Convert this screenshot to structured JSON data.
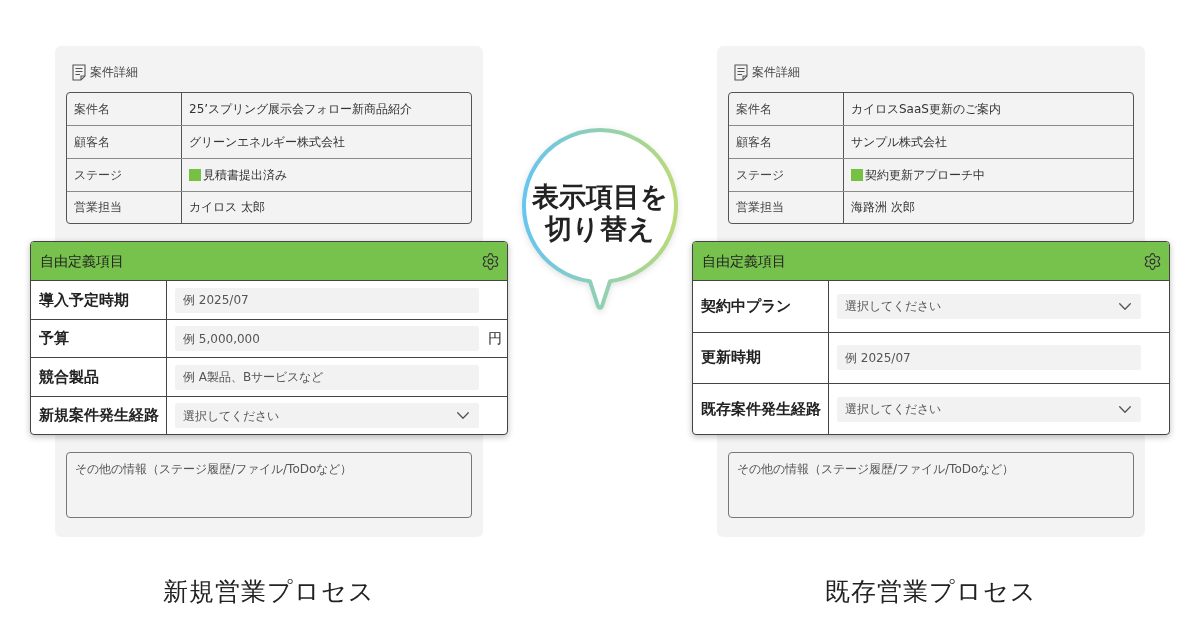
{
  "processes": [
    {
      "details": {
        "title": "案件詳細",
        "rows": [
          {
            "label": "案件名",
            "value": "25’スプリング展示会フォロー新商品紹介"
          },
          {
            "label": "顧客名",
            "value": "グリーンエネルギー株式会社"
          },
          {
            "label": "ステージ",
            "value": "見積書提出済み",
            "color": "#76c043"
          },
          {
            "label": "営業担当",
            "value": "カイロス 太郎"
          }
        ]
      },
      "custom_fields": {
        "title": "自由定義項目",
        "fields": [
          {
            "kind": "text",
            "label": "導入予定時期",
            "placeholder": "例 2025/07"
          },
          {
            "kind": "text",
            "label": "予算",
            "placeholder": "例 5,000,000",
            "unit": "円"
          },
          {
            "kind": "text",
            "label": "競合製品",
            "placeholder": "例 A製品、Bサービスなど"
          },
          {
            "kind": "select",
            "label": "新規案件発生経路",
            "placeholder": "選択してください"
          }
        ]
      },
      "notes": {
        "placeholder": "その他の情報（ステージ履歴/ファイル/ToDoなど）"
      },
      "caption": "新規営業プロセス"
    },
    {
      "details": {
        "title": "案件詳細",
        "rows": [
          {
            "label": "案件名",
            "value": "カイロスSaaS更新のご案内"
          },
          {
            "label": "顧客名",
            "value": "サンプル株式会社"
          },
          {
            "label": "ステージ",
            "value": "契約更新アプローチ中",
            "color": "#76c043"
          },
          {
            "label": "営業担当",
            "value": "海路洲 次郎"
          }
        ]
      },
      "custom_fields": {
        "title": "自由定義項目",
        "fields": [
          {
            "kind": "select",
            "label": "契約中プラン",
            "placeholder": "選択してください"
          },
          {
            "kind": "text",
            "label": "更新時期",
            "placeholder": "例 2025/07"
          },
          {
            "kind": "select",
            "label": "既存案件発生経路",
            "placeholder": "選択してください"
          }
        ]
      },
      "notes": {
        "placeholder": "その他の情報（ステージ履歴/ファイル/ToDoなど）"
      },
      "caption": "既存営業プロセス"
    }
  ],
  "bubble": {
    "lines": [
      "表示項目を",
      "切り替え"
    ]
  }
}
